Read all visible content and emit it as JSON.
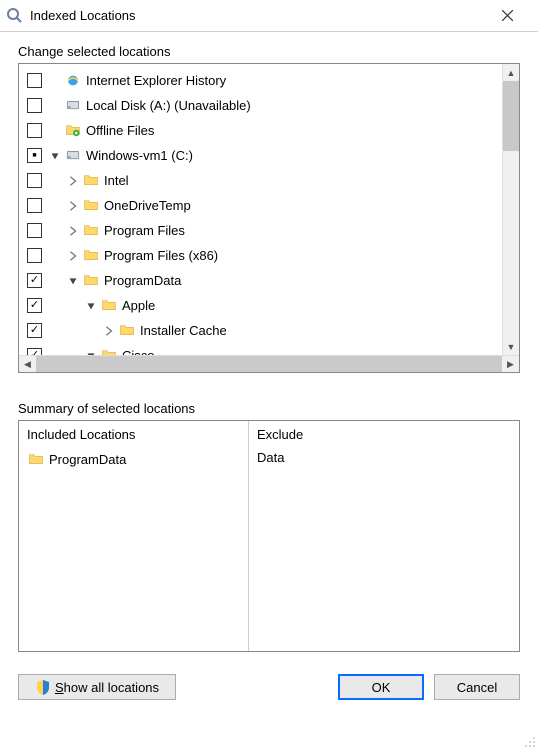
{
  "window": {
    "title": "Indexed Locations"
  },
  "labels": {
    "change": "Change selected locations",
    "summary": "Summary of selected locations"
  },
  "tree": [
    {
      "indent": 0,
      "checked": "",
      "arrow": "",
      "icon": "ie",
      "label": "Internet Explorer History"
    },
    {
      "indent": 0,
      "checked": "",
      "arrow": "",
      "icon": "disk",
      "label": "Local Disk (A:) (Unavailable)"
    },
    {
      "indent": 0,
      "checked": "",
      "arrow": "",
      "icon": "offline",
      "label": "Offline Files"
    },
    {
      "indent": 0,
      "checked": "dash",
      "arrow": "open",
      "icon": "disk",
      "label": "Windows-vm1 (C:)"
    },
    {
      "indent": 1,
      "checked": "",
      "arrow": "closed",
      "icon": "folder",
      "label": "Intel"
    },
    {
      "indent": 1,
      "checked": "",
      "arrow": "closed",
      "icon": "folder",
      "label": "OneDriveTemp"
    },
    {
      "indent": 1,
      "checked": "",
      "arrow": "closed",
      "icon": "folder",
      "label": "Program Files"
    },
    {
      "indent": 1,
      "checked": "",
      "arrow": "closed",
      "icon": "folder",
      "label": "Program Files (x86)"
    },
    {
      "indent": 1,
      "checked": "checked",
      "arrow": "open",
      "icon": "folder",
      "label": "ProgramData"
    },
    {
      "indent": 2,
      "checked": "checked",
      "arrow": "open",
      "icon": "folder",
      "label": "Apple"
    },
    {
      "indent": 3,
      "checked": "checked",
      "arrow": "closed",
      "icon": "folder",
      "label": "Installer Cache"
    },
    {
      "indent": 2,
      "checked": "checked",
      "arrow": "open",
      "icon": "folder",
      "label": "Cisco"
    }
  ],
  "summary": {
    "includedHeader": "Included Locations",
    "excludeHeader": "Exclude",
    "includedItems": [
      {
        "label": "ProgramData"
      }
    ],
    "excludeItems": [
      "Data"
    ]
  },
  "buttons": {
    "showAll": "Show all locations",
    "ok": "OK",
    "cancel": "Cancel"
  }
}
